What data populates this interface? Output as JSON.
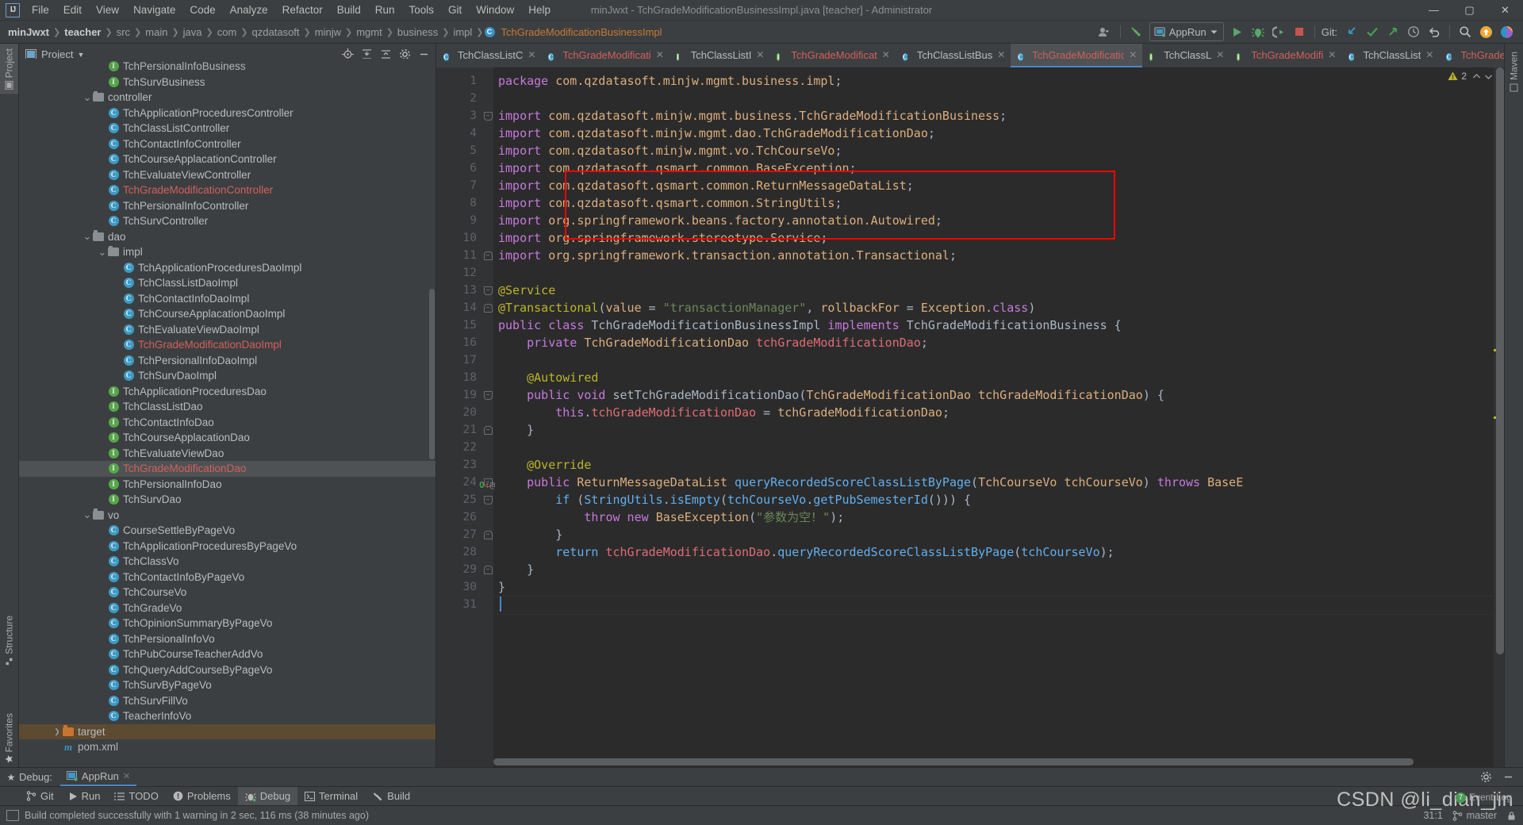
{
  "window": {
    "title": "minJwxt - TchGradeModificationBusinessImpl.java [teacher] - Administrator",
    "logo": "IJ",
    "minimize": "—",
    "maximize": "▢",
    "close": "✕"
  },
  "menubar": [
    "File",
    "Edit",
    "View",
    "Navigate",
    "Code",
    "Analyze",
    "Refactor",
    "Build",
    "Run",
    "Tools",
    "Git",
    "Window",
    "Help"
  ],
  "breadcrumbs": [
    {
      "label": "minJwxt",
      "style": "bold"
    },
    {
      "label": "teacher",
      "style": "bold"
    },
    {
      "label": "src",
      "style": "plain"
    },
    {
      "label": "main",
      "style": "plain"
    },
    {
      "label": "java",
      "style": "plain"
    },
    {
      "label": "com",
      "style": "plain"
    },
    {
      "label": "qzdatasoft",
      "style": "plain"
    },
    {
      "label": "minjw",
      "style": "plain"
    },
    {
      "label": "mgmt",
      "style": "plain"
    },
    {
      "label": "business",
      "style": "plain"
    },
    {
      "label": "impl",
      "style": "plain"
    },
    {
      "label": "TchGradeModificationBusinessImpl",
      "style": "file"
    }
  ],
  "toolbar": {
    "run_config": "AppRun",
    "git_label": "Git:",
    "icons": [
      "user-avatar-icon",
      "hammer-build-icon",
      "run-icon",
      "debug-icon",
      "run-with-coverage-icon",
      "stop-icon",
      "update-project-icon",
      "commit-icon",
      "push-icon",
      "history-icon",
      "rollback-icon",
      "search-everywhere-icon",
      "ide-update-icon",
      "ai-assistant-icon"
    ]
  },
  "project_panel": {
    "title": "Project",
    "tools": [
      "locate-icon",
      "expand-all-icon",
      "collapse-all-icon",
      "settings-gear-icon",
      "hide-icon"
    ],
    "tree": [
      {
        "label": "TchPersionalInfoBusiness",
        "type": "interface",
        "indent": 5,
        "color": "normal",
        "clipped": true
      },
      {
        "label": "TchSurvBusiness",
        "type": "interface",
        "indent": 5,
        "color": "normal"
      },
      {
        "label": "controller",
        "type": "folder",
        "indent": 4,
        "color": "normal",
        "arrow": "open"
      },
      {
        "label": "TchApplicationProceduresController",
        "type": "class",
        "indent": 5,
        "color": "normal"
      },
      {
        "label": "TchClassListController",
        "type": "class",
        "indent": 5,
        "color": "normal"
      },
      {
        "label": "TchContactInfoController",
        "type": "class",
        "indent": 5,
        "color": "normal"
      },
      {
        "label": "TchCourseApplacationController",
        "type": "class",
        "indent": 5,
        "color": "normal"
      },
      {
        "label": "TchEvaluateViewController",
        "type": "class",
        "indent": 5,
        "color": "normal"
      },
      {
        "label": "TchGradeModificationController",
        "type": "class",
        "indent": 5,
        "color": "red"
      },
      {
        "label": "TchPersionalInfoController",
        "type": "class",
        "indent": 5,
        "color": "normal"
      },
      {
        "label": "TchSurvController",
        "type": "class",
        "indent": 5,
        "color": "normal"
      },
      {
        "label": "dao",
        "type": "folder",
        "indent": 4,
        "color": "normal",
        "arrow": "open"
      },
      {
        "label": "impl",
        "type": "folder",
        "indent": 5,
        "color": "normal",
        "arrow": "open"
      },
      {
        "label": "TchApplicationProceduresDaoImpl",
        "type": "class",
        "indent": 6,
        "color": "normal"
      },
      {
        "label": "TchClassListDaoImpl",
        "type": "class",
        "indent": 6,
        "color": "normal"
      },
      {
        "label": "TchContactInfoDaoImpl",
        "type": "class",
        "indent": 6,
        "color": "normal"
      },
      {
        "label": "TchCourseApplacationDaoImpl",
        "type": "class",
        "indent": 6,
        "color": "normal"
      },
      {
        "label": "TchEvaluateViewDaoImpl",
        "type": "class",
        "indent": 6,
        "color": "normal"
      },
      {
        "label": "TchGradeModificationDaoImpl",
        "type": "class",
        "indent": 6,
        "color": "red"
      },
      {
        "label": "TchPersionalInfoDaoImpl",
        "type": "class",
        "indent": 6,
        "color": "normal"
      },
      {
        "label": "TchSurvDaoImpl",
        "type": "class",
        "indent": 6,
        "color": "normal"
      },
      {
        "label": "TchApplicationProceduresDao",
        "type": "interface",
        "indent": 5,
        "color": "normal"
      },
      {
        "label": "TchClassListDao",
        "type": "interface",
        "indent": 5,
        "color": "normal"
      },
      {
        "label": "TchContactInfoDao",
        "type": "interface",
        "indent": 5,
        "color": "normal"
      },
      {
        "label": "TchCourseApplacationDao",
        "type": "interface",
        "indent": 5,
        "color": "normal"
      },
      {
        "label": "TchEvaluateViewDao",
        "type": "interface",
        "indent": 5,
        "color": "normal"
      },
      {
        "label": "TchGradeModificationDao",
        "type": "interface",
        "indent": 5,
        "color": "red",
        "selected": true
      },
      {
        "label": "TchPersionalInfoDao",
        "type": "interface",
        "indent": 5,
        "color": "normal"
      },
      {
        "label": "TchSurvDao",
        "type": "interface",
        "indent": 5,
        "color": "normal"
      },
      {
        "label": "vo",
        "type": "folder",
        "indent": 4,
        "color": "normal",
        "arrow": "open"
      },
      {
        "label": "CourseSettleByPageVo",
        "type": "class",
        "indent": 5,
        "color": "normal"
      },
      {
        "label": "TchApplicationProceduresByPageVo",
        "type": "class",
        "indent": 5,
        "color": "normal"
      },
      {
        "label": "TchClassVo",
        "type": "class",
        "indent": 5,
        "color": "normal"
      },
      {
        "label": "TchContactInfoByPageVo",
        "type": "class",
        "indent": 5,
        "color": "normal"
      },
      {
        "label": "TchCourseVo",
        "type": "class",
        "indent": 5,
        "color": "normal"
      },
      {
        "label": "TchGradeVo",
        "type": "class",
        "indent": 5,
        "color": "normal"
      },
      {
        "label": "TchOpinionSummaryByPageVo",
        "type": "class",
        "indent": 5,
        "color": "normal"
      },
      {
        "label": "TchPersionalInfoVo",
        "type": "class",
        "indent": 5,
        "color": "normal"
      },
      {
        "label": "TchPubCourseTeacherAddVo",
        "type": "class",
        "indent": 5,
        "color": "normal"
      },
      {
        "label": "TchQueryAddCourseByPageVo",
        "type": "class",
        "indent": 5,
        "color": "normal"
      },
      {
        "label": "TchSurvByPageVo",
        "type": "class",
        "indent": 5,
        "color": "normal"
      },
      {
        "label": "TchSurvFillVo",
        "type": "class",
        "indent": 5,
        "color": "normal"
      },
      {
        "label": "TeacherInfoVo",
        "type": "class",
        "indent": 5,
        "color": "normal"
      },
      {
        "label": "target",
        "type": "folder-orange",
        "indent": 2,
        "color": "normal",
        "arrow": "closed",
        "highlight": "orange"
      },
      {
        "label": "pom.xml",
        "type": "maven",
        "indent": 2,
        "color": "normal",
        "clipped": true
      }
    ]
  },
  "left_rail": [
    {
      "label": "Project",
      "icon": "project-icon",
      "active": true
    },
    {
      "label": "Structure",
      "icon": "structure-icon",
      "active": false
    },
    {
      "label": "Favorites",
      "icon": "star-icon",
      "active": false
    }
  ],
  "editor_tabs": [
    {
      "label": "TchClassListC",
      "type": "class",
      "active": false
    },
    {
      "label": "TchGradeModificati",
      "type": "class",
      "active": false,
      "modified": true
    },
    {
      "label": "TchClassListI",
      "type": "interface",
      "active": false
    },
    {
      "label": "TchGradeModificat",
      "type": "interface",
      "active": false,
      "modified": true
    },
    {
      "label": "TchClassListBus",
      "type": "class",
      "active": false
    },
    {
      "label": "TchGradeModification",
      "type": "class",
      "active": true,
      "modified": true
    },
    {
      "label": "TchClassL",
      "type": "interface",
      "active": false
    },
    {
      "label": "TchGradeModifi",
      "type": "interface",
      "active": false,
      "modified": true
    },
    {
      "label": "TchClassList",
      "type": "class",
      "active": false
    },
    {
      "label": "TchGradeModification",
      "type": "class",
      "active": false,
      "modified": true
    }
  ],
  "editor": {
    "warning_count": "2",
    "first_line": 1,
    "last_line": 31,
    "lines": [
      {
        "n": 1,
        "html": "<span class=\"kwp\">package</span> <span class=\"pkg\">com.qzdatasoft.minjw.mgmt.business.impl</span><span class=\"pl\">;</span>"
      },
      {
        "n": 2,
        "html": ""
      },
      {
        "n": 3,
        "html": "<span class=\"kwp\">import</span> <span class=\"pkg\">com.qzdatasoft.minjw.mgmt.business.TchGradeModificationBusiness</span><span class=\"pl\">;</span>",
        "fold": "top"
      },
      {
        "n": 4,
        "html": "<span class=\"kwp\">import</span> <span class=\"pkg\">com.qzdatasoft.minjw.mgmt.dao.TchGradeModificationDao</span><span class=\"pl\">;</span>"
      },
      {
        "n": 5,
        "html": "<span class=\"kwp\">import</span> <span class=\"pkg\">com.qzdatasoft.minjw.mgmt.vo.TchCourseVo</span><span class=\"pl\">;</span>"
      },
      {
        "n": 6,
        "html": "<span class=\"kwp\">import</span> <span class=\"pkg\">com.qzdatasoft.qsmart.common.BaseException</span><span class=\"pl\">;</span>"
      },
      {
        "n": 7,
        "html": "<span class=\"kwp\">import</span> <span class=\"pkg\">com.qzdatasoft.qsmart.common.ReturnMessageDataList</span><span class=\"pl\">;</span>"
      },
      {
        "n": 8,
        "html": "<span class=\"kwp\">import</span> <span class=\"pkg\">com.qzdatasoft.qsmart.common.StringUtils</span><span class=\"pl\">;</span>"
      },
      {
        "n": 9,
        "html": "<span class=\"kwp\">import</span> <span class=\"pkg\">org.springframework.beans.factory.annotation.Autowired</span><span class=\"pl\">;</span>"
      },
      {
        "n": 10,
        "html": "<span class=\"kwp\">import</span> <span class=\"pkg\">org.springframework.stereotype.Service</span><span class=\"pl\">;</span>"
      },
      {
        "n": 11,
        "html": "<span class=\"kwp\">import</span> <span class=\"pkg\">org.springframework.transaction.annotation.Transactional</span><span class=\"pl\">;</span>",
        "fold": "bottom"
      },
      {
        "n": 12,
        "html": ""
      },
      {
        "n": 13,
        "html": "<span class=\"ann\">@Service</span>",
        "fold": "top"
      },
      {
        "n": 14,
        "html": "<span class=\"ann\">@Transactional</span><span class=\"pl\">(</span><span class=\"param\">value</span> <span class=\"pl\">=</span> <span class=\"str\">\"transactionManager\"</span><span class=\"pl\">,</span> <span class=\"param\">rollbackFor</span> <span class=\"pl\">=</span> <span class=\"param\">Exception</span><span class=\"pl\">.</span><span class=\"kwp\">class</span><span class=\"pl\">)</span>",
        "fold": "bottom"
      },
      {
        "n": 15,
        "html": "<span class=\"kwp\">public class</span> <span class=\"cls\">TchGradeModificationBusinessImpl</span> <span class=\"kwp\">implements</span> <span class=\"cls\">TchGradeModificationBusiness</span> <span class=\"pl\">{</span>"
      },
      {
        "n": 16,
        "html": "    <span class=\"kwp\">private</span> <span class=\"param\">TchGradeModificationDao</span> <span class=\"fld2\">tchGradeModificationDao</span><span class=\"pl\">;</span>"
      },
      {
        "n": 17,
        "html": ""
      },
      {
        "n": 18,
        "html": "    <span class=\"ann\">@Autowired</span>"
      },
      {
        "n": 19,
        "html": "    <span class=\"kwp\">public void</span> <span class=\"cls\">setTchGradeModificationDao</span><span class=\"pl\">(</span><span class=\"param\">TchGradeModificationDao</span> <span class=\"param\">tchGradeModificationDao</span><span class=\"pl\">) {</span>",
        "fold": "top"
      },
      {
        "n": 20,
        "html": "        <span class=\"kwp\">this</span><span class=\"pl\">.</span><span class=\"fld2\">tchGradeModificationDao</span> <span class=\"pl\">=</span> <span class=\"param\">tchGradeModificationDao</span><span class=\"pl\">;</span>"
      },
      {
        "n": 21,
        "html": "    <span class=\"pl\">}</span>",
        "fold": "bottom"
      },
      {
        "n": 22,
        "html": ""
      },
      {
        "n": 23,
        "html": "    <span class=\"ann\">@Override</span>"
      },
      {
        "n": 24,
        "html": "    <span class=\"kwp\">public</span> <span class=\"param\">ReturnMessageDataList</span> <span class=\"mth\">queryRecordedScoreClassListByPage</span><span class=\"pl\">(</span><span class=\"param\">TchCourseVo</span> <span class=\"param\">tchCourseVo</span><span class=\"pl\">)</span> <span class=\"kwp\">throws</span> <span class=\"param\">BaseE</span>",
        "fold": "top",
        "gutter_marks": [
          "override-icon",
          "annotation-icon"
        ]
      },
      {
        "n": 25,
        "html": "        <span class=\"mth\">if</span> <span class=\"pl\">(</span><span class=\"mth\">StringUtils</span><span class=\"pl\">.</span><span class=\"mth\">isEmpty</span><span class=\"pl\">(</span><span class=\"mth\">tchCourseVo</span><span class=\"pl\">.</span><span class=\"mth\">getPubSemesterId</span><span class=\"pl\">())) {</span>",
        "fold": "top"
      },
      {
        "n": 26,
        "html": "            <span class=\"kwp\">throw new</span> <span class=\"param\">BaseException</span><span class=\"pl\">(</span><span class=\"str\">\"参数为空！\"</span><span class=\"pl\">);</span>"
      },
      {
        "n": 27,
        "html": "        <span class=\"pl\">}</span>",
        "fold": "bottom"
      },
      {
        "n": 28,
        "html": "        <span class=\"mth\">return</span> <span class=\"fld2\">tchGradeModificationDao</span><span class=\"pl\">.</span><span class=\"mth\">queryRecordedScoreClassListByPage</span><span class=\"pl\">(</span><span class=\"mth\">tchCourseVo</span><span class=\"pl\">);</span>"
      },
      {
        "n": 29,
        "html": "    <span class=\"pl\">}</span>",
        "fold": "bottom"
      },
      {
        "n": 30,
        "html": "<span class=\"pl\">}</span>"
      },
      {
        "n": 31,
        "html": ""
      }
    ]
  },
  "debug_window": {
    "label": "Debug:",
    "tab": "AppRun",
    "close": "✕"
  },
  "bottom_tabs": [
    {
      "label": "Git",
      "icon": "git-branch-icon",
      "active": false
    },
    {
      "label": "Run",
      "icon": "run-icon",
      "active": false
    },
    {
      "label": "TODO",
      "icon": "todo-icon",
      "active": false
    },
    {
      "label": "Problems",
      "icon": "problems-icon",
      "active": false
    },
    {
      "label": "Debug",
      "icon": "debug-bug-icon",
      "active": true
    },
    {
      "label": "Terminal",
      "icon": "terminal-icon",
      "active": false
    },
    {
      "label": "Build",
      "icon": "build-hammer-icon",
      "active": false
    }
  ],
  "status_bar": {
    "message": "Build completed successfully with 1 warning in 2 sec, 116 ms (38 minutes ago)",
    "event_log": "Event Log",
    "event_count": "7",
    "caret_position": "31:1",
    "branch": "master",
    "lock_icon": "lock-icon"
  },
  "watermark": "CSDN @li_dian_jin",
  "colors": {
    "accent_blue": "#4a88c7",
    "panel_bg": "#3c3f41",
    "editor_bg": "#2b2b2b",
    "gutter_bg": "#313335",
    "highlight_red": "#ff0000",
    "class_red": "#d2605b",
    "string_green": "#6a8759",
    "keyword_orange": "#cc7832"
  }
}
